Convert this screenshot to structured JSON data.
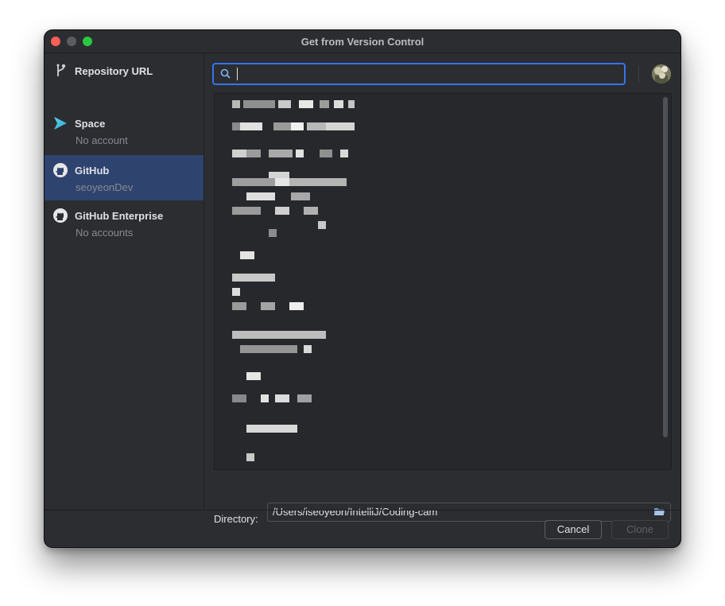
{
  "window": {
    "title": "Get from Version Control"
  },
  "sidebar": {
    "items": [
      {
        "label": "Repository URL",
        "sub": "",
        "icon": "branch-icon"
      },
      {
        "label": "Space",
        "sub": "No account",
        "icon": "space-logo-icon"
      },
      {
        "label": "GitHub",
        "sub": "seoyeonDev",
        "icon": "github-icon",
        "selected": true
      },
      {
        "label": "GitHub Enterprise",
        "sub": "No accounts",
        "icon": "github-icon"
      }
    ]
  },
  "search": {
    "value": "",
    "placeholder": ""
  },
  "directory": {
    "label": "Directory:",
    "value": "/Users/iseoyeon/IntelliJ/Coding-cam"
  },
  "buttons": {
    "cancel": "Cancel",
    "clone": "Clone"
  },
  "colors": {
    "accent": "#3574f0",
    "selection": "#2e436e",
    "background": "#2b2d30"
  }
}
